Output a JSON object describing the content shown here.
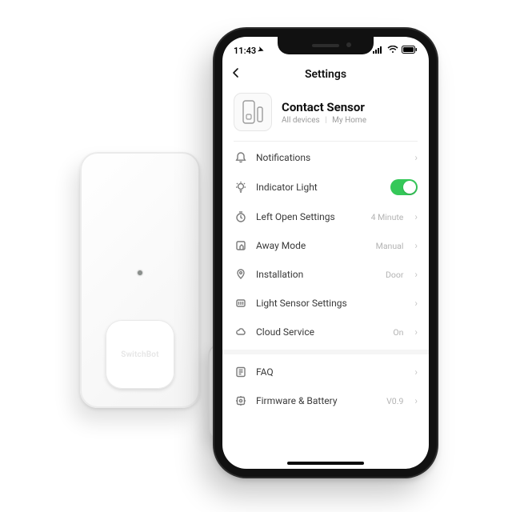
{
  "statusbar": {
    "time": "11:43",
    "location_arrow": "➤"
  },
  "nav": {
    "title": "Settings"
  },
  "device": {
    "brand": "SwitchBot",
    "name": "Contact Sensor",
    "scope_a": "All devices",
    "scope_b": "My Home"
  },
  "rows": {
    "notifications": "Notifications",
    "indicator_light": "Indicator Light",
    "left_open": "Left Open Settings",
    "left_open_val": "4 Minute",
    "away_mode": "Away Mode",
    "away_mode_val": "Manual",
    "installation": "Installation",
    "installation_val": "Door",
    "light_sensor": "Light Sensor Settings",
    "cloud": "Cloud Service",
    "cloud_val": "On",
    "faq": "FAQ",
    "firmware": "Firmware & Battery",
    "firmware_val": "V0.9"
  }
}
